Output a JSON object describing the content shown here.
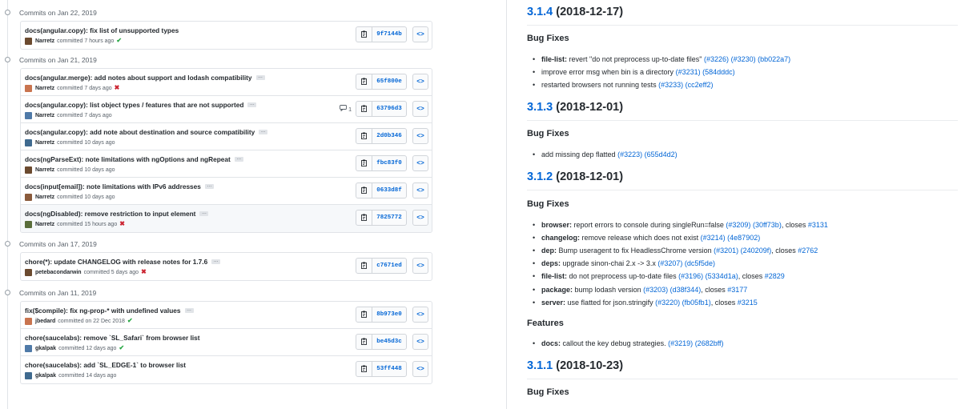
{
  "commits_panel": {
    "groups": [
      {
        "date": "Commits on Jan 22, 2019",
        "commits": [
          {
            "title": "docs(angular.copy): fix list of unsupported types",
            "author": "Narretz",
            "time": "committed 7 hours ago",
            "status": "✔",
            "sha": "9f7144b",
            "browse": "<>"
          }
        ]
      },
      {
        "date": "Commits on Jan 21, 2019",
        "commits": [
          {
            "title": "docs(angular.merge): add notes about support and lodash compatibility",
            "author": "Narretz",
            "time": "committed 7 days ago",
            "status": "✖",
            "sha": "65f800e",
            "browse": "<>"
          },
          {
            "title": "docs(angular.copy): list object types / features that are not supported",
            "author": "Narretz",
            "time": "committed 7 days ago",
            "comments": "1",
            "sha": "63796d3",
            "browse": "<>"
          },
          {
            "title": "docs(angular.copy): add note about destination and source compatibility",
            "author": "Narretz",
            "time": "committed 10 days ago",
            "sha": "2d0b346",
            "browse": "<>"
          },
          {
            "title": "docs(ngParseExt): note limitations with ngOptions and ngRepeat",
            "author": "Narretz",
            "time": "committed 10 days ago",
            "sha": "fbc83f0",
            "browse": "<>"
          },
          {
            "title": "docs(input[email]): note limitations with IPv6 addresses",
            "author": "Narretz",
            "time": "committed 10 days ago",
            "sha": "0633d8f",
            "browse": "<>"
          },
          {
            "title": "docs(ngDisabled): remove restriction to input element",
            "author": "Narretz",
            "time": "committed 15 hours ago",
            "status": "✖",
            "sha": "7825772",
            "browse": "<>"
          }
        ]
      },
      {
        "date": "Commits on Jan 17, 2019",
        "commits": [
          {
            "title": "chore(*): update CHANGELOG with release notes for 1.7.6",
            "author": "petebacondarwin",
            "time": "committed 5 days ago",
            "status": "✖",
            "sha": "c7671ed",
            "browse": "<>"
          }
        ]
      },
      {
        "date": "Commits on Jan 11, 2019",
        "commits": [
          {
            "title": "fix($compile): fix ng-prop-* with undefined values",
            "author": "jbedard",
            "time": "committed on 22 Dec 2018",
            "status": "✔",
            "sha": "8b973e0",
            "browse": "<>"
          },
          {
            "title": "chore(saucelabs): remove `SL_Safari` from browser list",
            "author": "gkalpak",
            "time": "committed 12 days ago",
            "status": "✔",
            "sha": "be45d3c",
            "browse": "<>"
          },
          {
            "title": "chore(saucelabs): add `SL_EDGE-1` to browser list",
            "author": "gkalpak",
            "time": "committed 14 days ago",
            "sha": "53ff448",
            "browse": "<>"
          }
        ]
      }
    ]
  },
  "changelog": {
    "releases": [
      {
        "version": "3.1.4",
        "date": "(2018-12-17)",
        "sections": [
          {
            "title": "Bug Fixes",
            "items": [
              {
                "scope": "file-list:",
                "text": "revert \"do not preprocess up-to-date files\"",
                "links": [
                  "(#3226)",
                  "(#3230)",
                  "(bb022a7)"
                ]
              },
              {
                "scope": "",
                "text": "improve error msg when bin is a directory",
                "links": [
                  "(#3231)",
                  "(584dddc)"
                ]
              },
              {
                "scope": "",
                "text": "restarted browsers not running tests",
                "links": [
                  "(#3233)",
                  "(cc2eff2)"
                ]
              }
            ]
          }
        ]
      },
      {
        "version": "3.1.3",
        "date": "(2018-12-01)",
        "sections": [
          {
            "title": "Bug Fixes",
            "items": [
              {
                "scope": "",
                "text": "add missing dep flatted",
                "links": [
                  "(#3223)",
                  "(655d4d2)"
                ]
              }
            ]
          }
        ]
      },
      {
        "version": "3.1.2",
        "date": "(2018-12-01)",
        "sections": [
          {
            "title": "Bug Fixes",
            "items": [
              {
                "scope": "browser:",
                "text": "report errors to console during singleRun=false",
                "links": [
                  "(#3209)",
                  "(30ff73b)"
                ],
                "closes": "#3131"
              },
              {
                "scope": "changelog:",
                "text": "remove release which does not exist",
                "links": [
                  "(#3214)",
                  "(4e87902)"
                ]
              },
              {
                "scope": "dep:",
                "text": "Bump useragent to fix HeadlessChrome version",
                "links": [
                  "(#3201)",
                  "(240209f)"
                ],
                "closes": "#2762"
              },
              {
                "scope": "deps:",
                "text": "upgrade sinon-chai 2.x -> 3.x",
                "links": [
                  "(#3207)",
                  "(dc5f5de)"
                ]
              },
              {
                "scope": "file-list:",
                "text": "do not preprocess up-to-date files",
                "links": [
                  "(#3196)",
                  "(5334d1a)"
                ],
                "closes": "#2829"
              },
              {
                "scope": "package:",
                "text": "bump lodash version",
                "links": [
                  "(#3203)",
                  "(d38f344)"
                ],
                "closes": "#3177"
              },
              {
                "scope": "server:",
                "text": "use flatted for json.stringify",
                "links": [
                  "(#3220)",
                  "(fb05fb1)"
                ],
                "closes": "#3215"
              }
            ]
          },
          {
            "title": "Features",
            "items": [
              {
                "scope": "docs:",
                "text": "callout the key debug strategies.",
                "links": [
                  "(#3219)",
                  "(2682bff)"
                ]
              }
            ]
          }
        ]
      },
      {
        "version": "3.1.1",
        "date": "(2018-10-23)",
        "sections": [
          {
            "title": "Bug Fixes",
            "items": []
          }
        ]
      }
    ],
    "closes_word": "closes"
  },
  "colors": {
    "link": "#0366d6",
    "success": "#28a745",
    "failure": "#cb2431",
    "border": "#e1e4e8"
  },
  "icons": {
    "copy": "clipboard-icon",
    "browse": "code-icon",
    "comment": "comment-icon",
    "timeline": "git-commit-icon"
  }
}
